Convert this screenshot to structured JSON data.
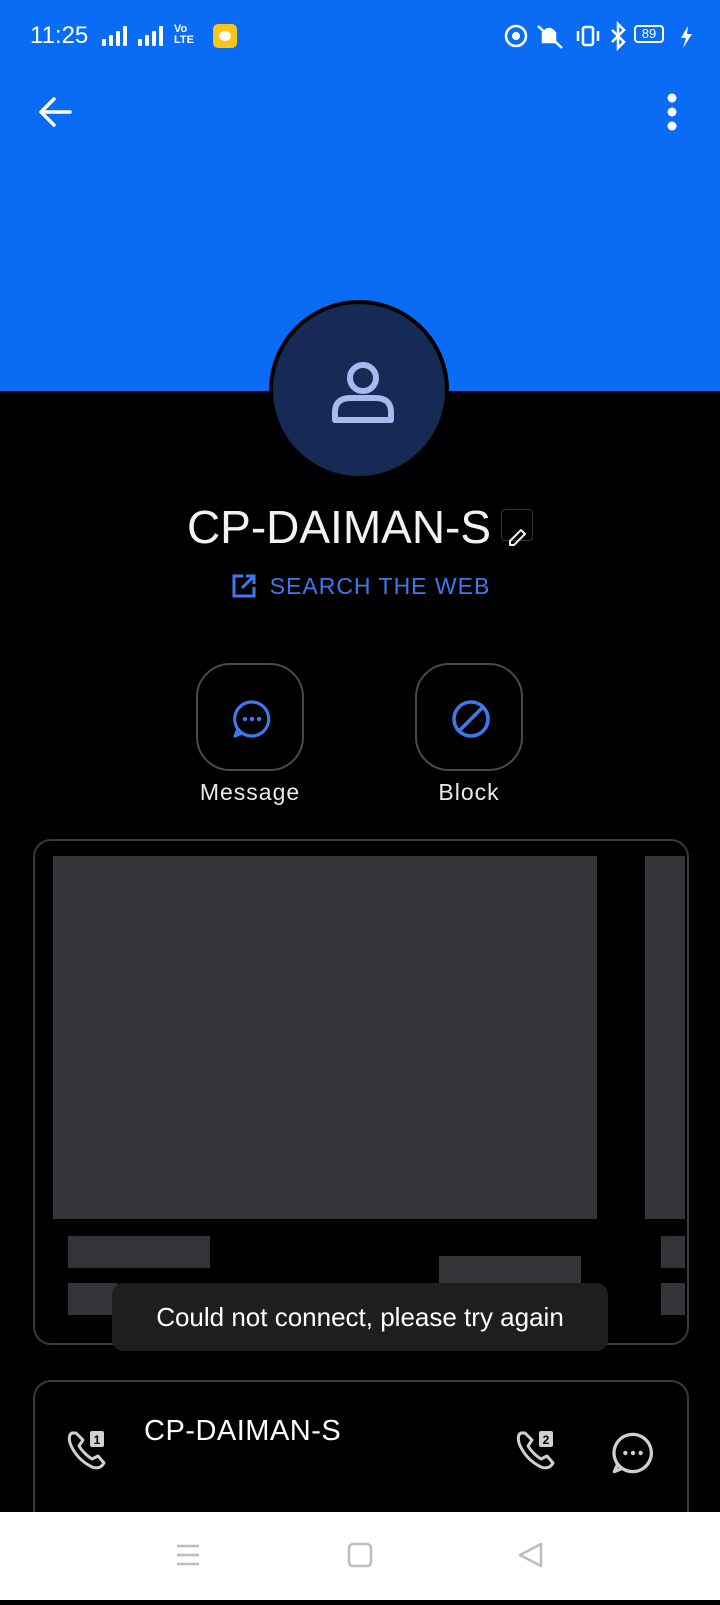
{
  "status_bar": {
    "time": "11:25",
    "volte": [
      "Vo",
      "LTE"
    ],
    "battery": "89"
  },
  "top_bar": {
    "back_icon": "arrow-left-icon",
    "more_icon": "more-vertical-icon"
  },
  "contact": {
    "name": "CP-DAIMAN-S",
    "search_web_label": "SEARCH THE WEB"
  },
  "actions": [
    {
      "label": "Message",
      "icon": "message-icon"
    },
    {
      "label": "Block",
      "icon": "block-icon"
    }
  ],
  "toast": "Could not connect, please try again",
  "number_card": {
    "name": "CP-DAIMAN-S",
    "sim1_icon": "call-sim1-icon",
    "sim2_icon": "call-sim2-icon",
    "message_icon": "message-icon"
  },
  "colors": {
    "header": "#0a6cf5",
    "accent": "#3d79ea",
    "avatar": "#172a55",
    "background": "#000000"
  }
}
